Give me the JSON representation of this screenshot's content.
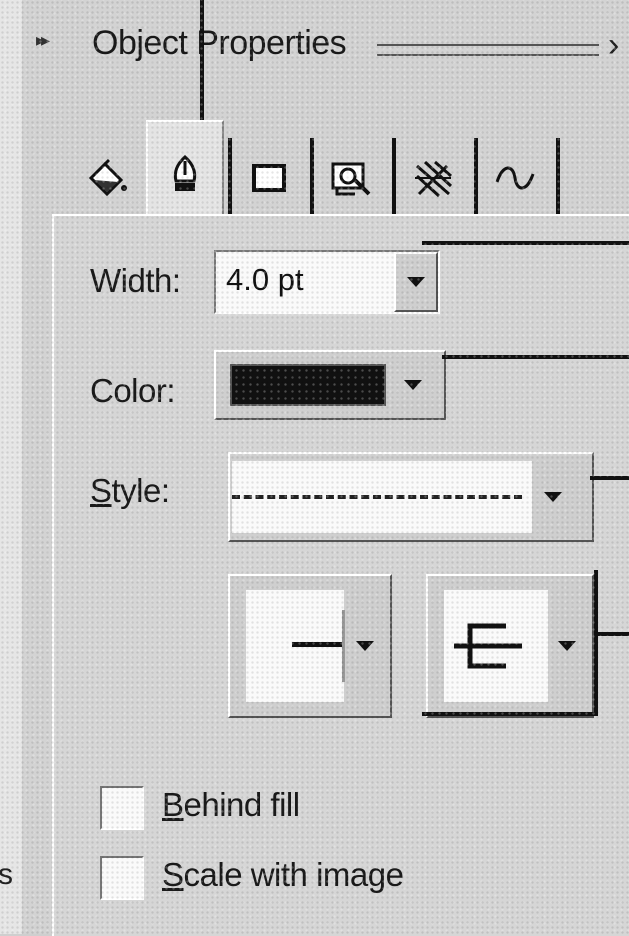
{
  "panel": {
    "title": "Object Properties",
    "collapse_icon": "double-chevron-right-icon",
    "more_icon": "chevron-right-icon"
  },
  "tabs": [
    {
      "name": "fill",
      "icon": "paint-bucket-icon",
      "selected": false
    },
    {
      "name": "outline",
      "icon": "pen-nib-icon",
      "selected": true
    },
    {
      "name": "rectangle",
      "icon": "rectangle-icon",
      "selected": false
    },
    {
      "name": "bitmap",
      "icon": "bitmap-icon",
      "selected": false
    },
    {
      "name": "effects",
      "icon": "hatch-icon",
      "selected": false
    },
    {
      "name": "curve",
      "icon": "curve-icon",
      "selected": false
    }
  ],
  "outline": {
    "width_label": "Width:",
    "width_value": "4.0 pt",
    "color_label": "Color:",
    "color_value": "#111111",
    "style_label": "Style:",
    "style_mnemonic": "S",
    "style_rest": "tyle:",
    "line_style": "dashed",
    "start_arrow": "line-end-icon",
    "end_arrow": "trident-arrow-icon"
  },
  "options": {
    "behind_fill_mnemonic": "B",
    "behind_fill_rest": "ehind fill",
    "behind_fill_checked": false,
    "scale_mnemonic": "S",
    "scale_rest": "cale with image",
    "scale_checked": false
  },
  "margin_text": "s"
}
